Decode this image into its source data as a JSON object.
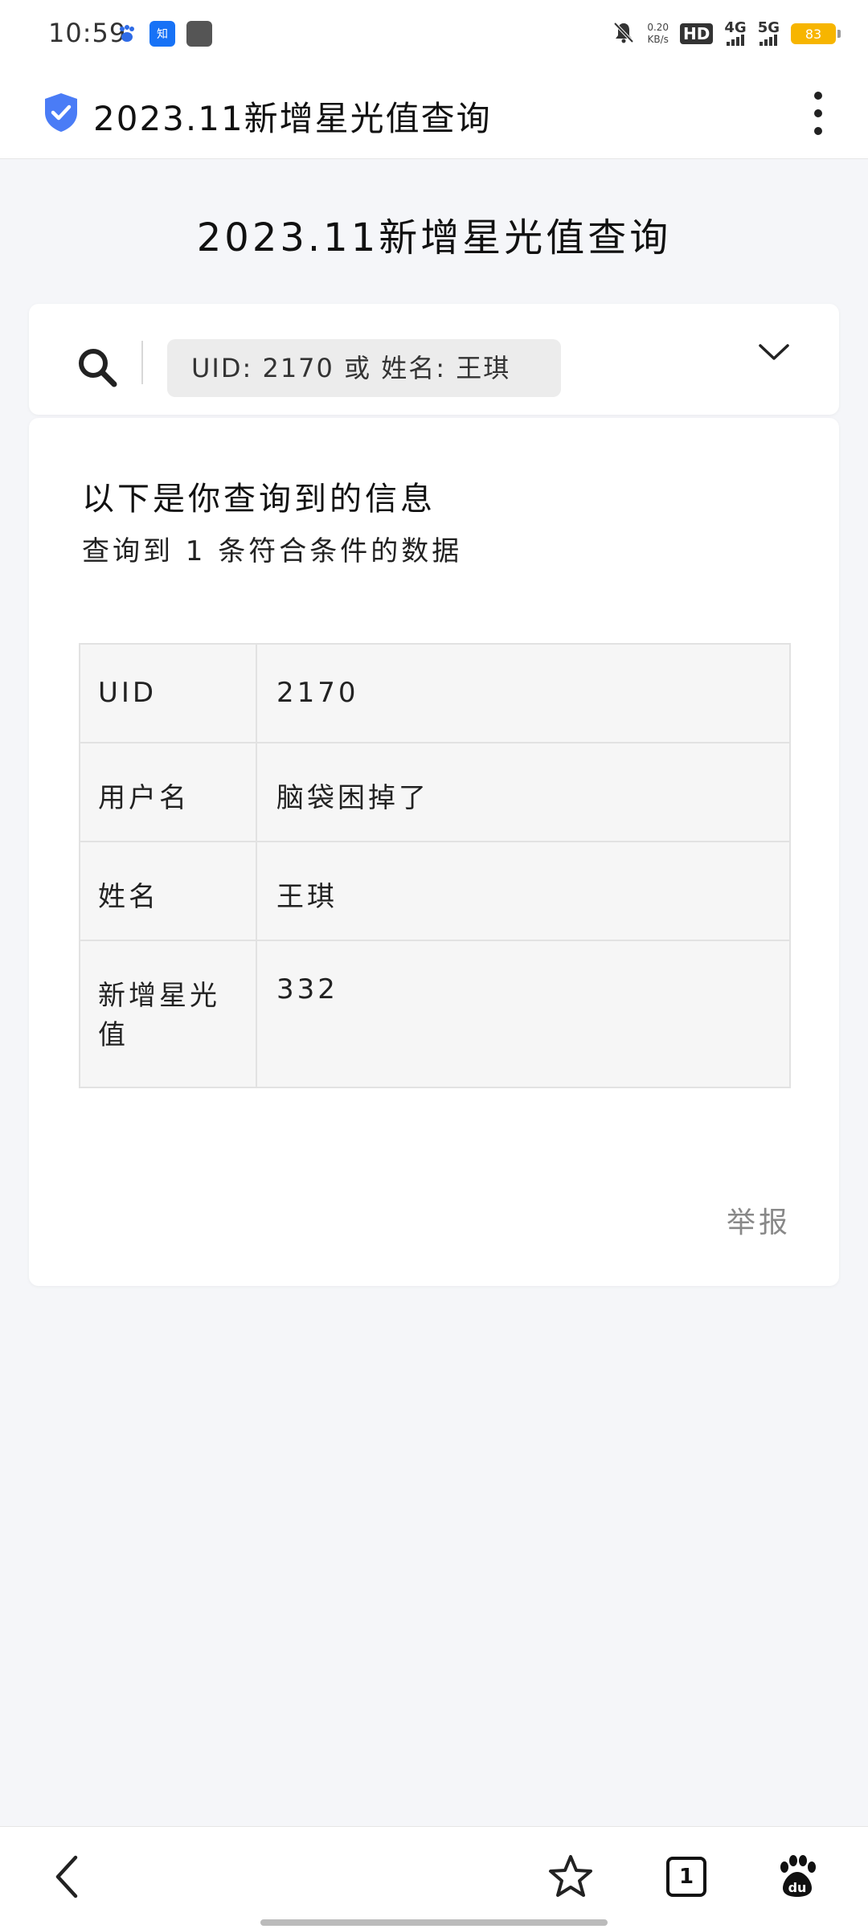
{
  "status_bar": {
    "time": "10:59",
    "net_speed_value": "0.20",
    "net_speed_unit": "KB/s",
    "hd_label": "HD",
    "net_1": "4G",
    "net_2": "5G",
    "battery": "83",
    "icons": [
      "baidu-paw-icon",
      "zhihu-icon",
      "app-icon",
      "bell-muted-icon"
    ]
  },
  "header": {
    "title": "2023.11新增星光值查询",
    "icons": [
      "shield-check-icon",
      "more-vertical-icon"
    ]
  },
  "page": {
    "title": "2023.11新增星光值查询"
  },
  "search": {
    "placeholder": "UID: 2170 或 姓名: 王琪",
    "icons": [
      "search-icon",
      "chevron-down-icon"
    ]
  },
  "result": {
    "heading": "以下是你查询到的信息",
    "count_text": "查询到 1 条符合条件的数据",
    "rows": [
      {
        "key": "UID",
        "value": "2170"
      },
      {
        "key": "用户名",
        "value": "脑袋困掉了"
      },
      {
        "key": "姓名",
        "value": "王琪"
      },
      {
        "key": "新增星光值",
        "value": "332"
      }
    ],
    "report_label": "举报"
  },
  "bottom_nav": {
    "tab_count": "1",
    "icons": [
      "back-icon",
      "star-icon",
      "tabs-icon",
      "baidu-paw-icon"
    ]
  },
  "colors": {
    "accent_blue": "#4a7cf6",
    "background": "#f5f6f9",
    "battery": "#f7b500"
  }
}
